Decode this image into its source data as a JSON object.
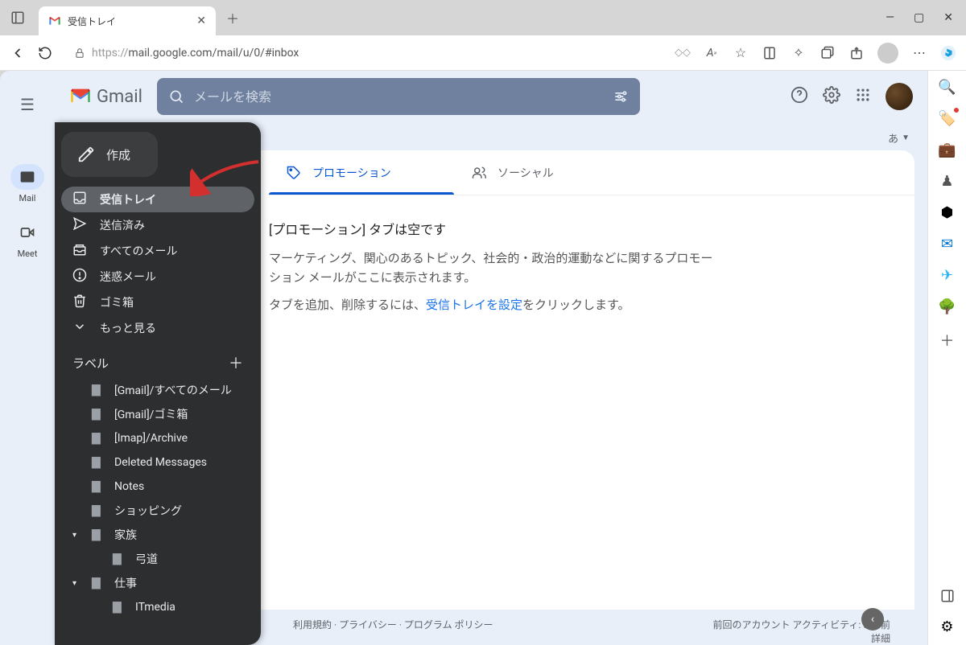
{
  "browser": {
    "tab_title": "受信トレイ",
    "url_proto": "https://",
    "url_rest": "mail.google.com/mail/u/0/#inbox"
  },
  "rail": {
    "mail": "Mail",
    "meet": "Meet"
  },
  "header": {
    "logo_text": "Gmail",
    "search_placeholder": "メールを検索",
    "lang_label": "あ"
  },
  "compose": {
    "label": "作成"
  },
  "nav": {
    "items": [
      {
        "label": "受信トレイ",
        "icon": "inbox"
      },
      {
        "label": "送信済み",
        "icon": "send"
      },
      {
        "label": "すべてのメール",
        "icon": "stack"
      },
      {
        "label": "迷惑メール",
        "icon": "spam"
      },
      {
        "label": "ゴミ箱",
        "icon": "trash"
      },
      {
        "label": "もっと見る",
        "icon": "expand"
      }
    ]
  },
  "labels": {
    "header": "ラベル",
    "items": [
      {
        "label": "[Gmail]/すべてのメール",
        "expandable": false,
        "indent": 0
      },
      {
        "label": "[Gmail]/ゴミ箱",
        "expandable": false,
        "indent": 0
      },
      {
        "label": "[Imap]/Archive",
        "expandable": false,
        "indent": 0
      },
      {
        "label": "Deleted Messages",
        "expandable": false,
        "indent": 0
      },
      {
        "label": "Notes",
        "expandable": false,
        "indent": 0
      },
      {
        "label": "ショッピング",
        "expandable": false,
        "indent": 0
      },
      {
        "label": "家族",
        "expandable": true,
        "indent": 0
      },
      {
        "label": "弓道",
        "expandable": false,
        "indent": 1
      },
      {
        "label": "仕事",
        "expandable": true,
        "indent": 0
      },
      {
        "label": "ITmedia",
        "expandable": false,
        "indent": 1
      }
    ]
  },
  "tabs": {
    "promotions": "プロモーション",
    "social": "ソーシャル"
  },
  "empty": {
    "title": "[プロモーション] タブは空です",
    "desc": "マーケティング、関心のあるトピック、社会的・政治的運動などに関するプロモーション メールがここに表示されます。",
    "action_pre": "タブを追加、削除するには、",
    "action_link": "受信トレイを設定",
    "action_post": "をクリックします。"
  },
  "footer": {
    "left": "利用規約 · プライバシー · プログラム ポリシー",
    "right_top": "前回のアカウント アクティビティ: 0 分前",
    "right_bottom": "詳細"
  }
}
